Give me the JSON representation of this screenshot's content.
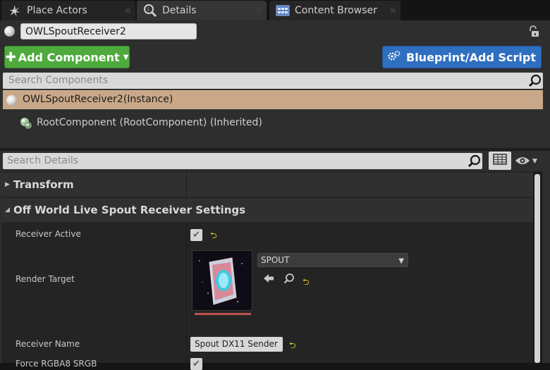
{
  "tabs": [
    {
      "label": "Place Actors",
      "icon": "place-actors-icon"
    },
    {
      "label": "Details",
      "icon": "details-icon"
    },
    {
      "label": "Content Browser",
      "icon": "content-browser-icon"
    }
  ],
  "actor": {
    "name": "OWLSpoutReceiver2"
  },
  "toolbar": {
    "add_component_label": "Add Component",
    "blueprint_label": "Blueprint/Add Script"
  },
  "components": {
    "search_placeholder": "Search Components",
    "instance_label": "OWLSpoutReceiver2(Instance)",
    "root_label": "RootComponent (RootComponent) (Inherited)"
  },
  "details": {
    "search_placeholder": "Search Details",
    "categories": [
      {
        "label": "Transform",
        "expanded": false
      },
      {
        "label": "Off World Live Spout Receiver Settings",
        "expanded": true
      }
    ],
    "properties": {
      "receiver_active": {
        "label": "Receiver Active",
        "checked": true
      },
      "render_target": {
        "label": "Render Target",
        "asset": "SPOUT"
      },
      "receiver_name": {
        "label": "Receiver Name",
        "value": "Spout DX11 Sender"
      },
      "force_rgba8": {
        "label": "Force RGBA8 SRGB",
        "checked": true
      }
    }
  },
  "colors": {
    "add_button": "#4faa3e",
    "blueprint_button": "#2f6fc0",
    "selected_row": "#c8a888",
    "reset_arrow": "#e0d020"
  }
}
